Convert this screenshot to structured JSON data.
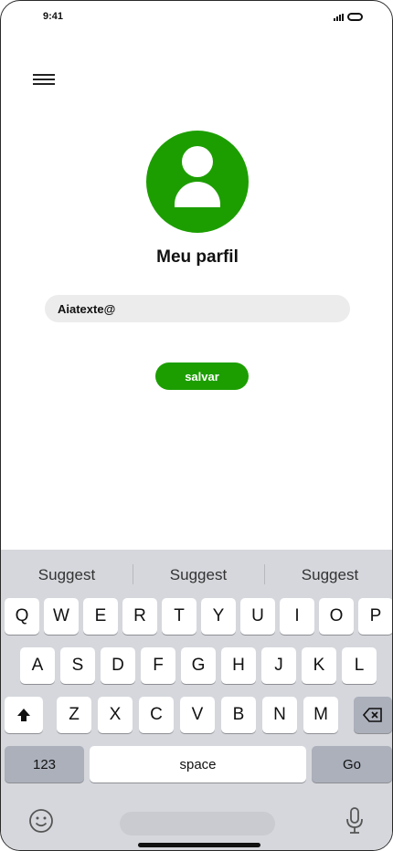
{
  "status_bar": {
    "time": "9:41"
  },
  "profile": {
    "title": "Meu parfil",
    "username_value": "Aiatexte@",
    "save_label": "salvar",
    "accent_color": "#1c9e00"
  },
  "keyboard": {
    "suggestions": [
      "Suggest",
      "Suggest",
      "Suggest"
    ],
    "row1": [
      "Q",
      "W",
      "E",
      "R",
      "T",
      "Y",
      "U",
      "I",
      "O",
      "P"
    ],
    "row2": [
      "A",
      "S",
      "D",
      "F",
      "G",
      "H",
      "J",
      "K",
      "L"
    ],
    "row3": [
      "Z",
      "X",
      "C",
      "V",
      "B",
      "N",
      "M"
    ],
    "numbers_label": "123",
    "space_label": "space",
    "go_label": "Go",
    "icons": [
      "shift-icon",
      "backspace-icon",
      "emoji-icon",
      "microphone-icon"
    ]
  }
}
